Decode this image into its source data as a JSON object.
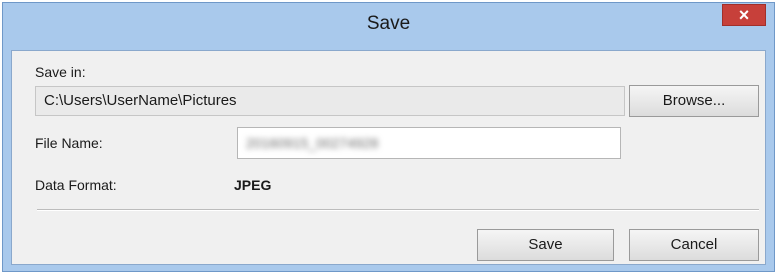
{
  "window": {
    "title": "Save",
    "close_glyph": "×"
  },
  "save_in": {
    "label": "Save in:",
    "path": "C:\\Users\\UserName\\Pictures",
    "browse_label": "Browse..."
  },
  "file_name": {
    "label": "File Name:",
    "value": "20160915_00274928"
  },
  "data_format": {
    "label": "Data Format:",
    "value": "JPEG"
  },
  "buttons": {
    "save_label": "Save",
    "cancel_label": "Cancel"
  },
  "colors": {
    "titlebar": "#a9c9ec",
    "close": "#c7403a",
    "client": "#f0f0f0"
  },
  "icons": {
    "close": "close-icon"
  }
}
